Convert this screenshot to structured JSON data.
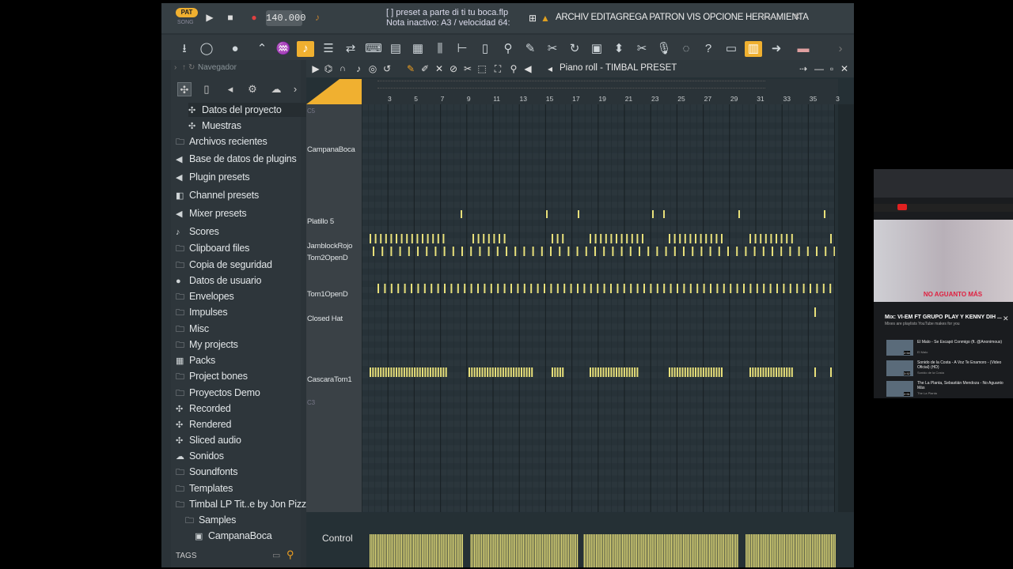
{
  "topbar": {
    "pat_label": "PAT",
    "song_label": "SONG",
    "bpm": "140.000",
    "hint_line1": "[    ] preset a parte di ti tu boca.flp",
    "hint_line2": "Nota inactivo: A3 / velocidad 64:",
    "menu": "ARCHIV EDITAGREGA PATRON VIS OPCIONE HERRAMIENTA"
  },
  "browser": {
    "header": "Navegador",
    "tags_label": "TAGS",
    "items": [
      {
        "label": "Datos del proyecto",
        "icon": "project-data-icon"
      },
      {
        "label": "Muestras",
        "icon": "samples-icon"
      },
      {
        "label": "Archivos recientes",
        "icon": "recent-files-icon"
      },
      {
        "label": "Base de datos de plugins",
        "icon": "plugin-database-icon"
      },
      {
        "label": "Plugin presets",
        "icon": "plugin-presets-icon"
      },
      {
        "label": "Channel presets",
        "icon": "channel-presets-icon"
      },
      {
        "label": "Mixer presets",
        "icon": "mixer-presets-icon"
      },
      {
        "label": "Scores",
        "icon": "scores-icon"
      },
      {
        "label": "Clipboard files",
        "icon": "folder-icon"
      },
      {
        "label": "Copia de seguridad",
        "icon": "backup-icon"
      },
      {
        "label": "Datos de usuario",
        "icon": "user-data-icon"
      },
      {
        "label": "Envelopes",
        "icon": "folder-icon"
      },
      {
        "label": "Impulses",
        "icon": "folder-icon"
      },
      {
        "label": "Misc",
        "icon": "folder-icon"
      },
      {
        "label": "My projects",
        "icon": "folder-icon"
      },
      {
        "label": "Packs",
        "icon": "packs-icon"
      },
      {
        "label": "Project bones",
        "icon": "folder-icon"
      },
      {
        "label": "Proyectos Demo",
        "icon": "folder-icon"
      },
      {
        "label": "Recorded",
        "icon": "recorded-icon"
      },
      {
        "label": "Rendered",
        "icon": "rendered-icon"
      },
      {
        "label": "Sliced audio",
        "icon": "sliced-audio-icon"
      },
      {
        "label": "Sonidos",
        "icon": "cloud-icon"
      },
      {
        "label": "Soundfonts",
        "icon": "folder-icon"
      },
      {
        "label": "Templates",
        "icon": "folder-icon"
      },
      {
        "label": "Timbal LP Tit..e by Jon Pizzio",
        "icon": "folder-open-icon"
      },
      {
        "label": "Samples",
        "icon": "folder-open-icon"
      },
      {
        "label": "CampanaBoca",
        "icon": "sample-icon"
      }
    ]
  },
  "pianoroll": {
    "title": "Piano roll - TIMBAL PRESET",
    "ruler": [
      "3",
      "5",
      "7",
      "9",
      "11",
      "13",
      "15",
      "17",
      "19",
      "21",
      "23",
      "25",
      "27",
      "29",
      "31",
      "33",
      "35",
      "3"
    ],
    "keys": [
      "C5",
      "CampanaBoca",
      "Platillo 5",
      "JamblockRojo",
      "Tom2OpenD",
      "Tom1OpenD",
      "Closed Hat",
      "CascaraTom1",
      "C3"
    ],
    "control_label": "Control"
  },
  "youtube": {
    "title": "Mix: VI-EM FT GRUPO PLAY Y KENNY DIH ...",
    "subtitle": "Mixes are playlists YouTube makes for you",
    "banner_text": "NO AGUANTO MÁS",
    "videos": [
      {
        "title": "El Malo - Se Escapó Conmigo (ft. @Anonimous)",
        "channel": "El Malo",
        "duration": "2:54"
      },
      {
        "title": "Sonido de la Costa - A Voz Te Enamoro - (Video Oficial) (HD)",
        "channel": "Sonido de la Costa",
        "duration": "3:52"
      },
      {
        "title": "The La Planta, Sebastián Mendoza - No Aguanto Más",
        "channel": "The La Planta",
        "duration": "2:51"
      }
    ]
  },
  "colors": {
    "accent": "#f0b030",
    "note": "#e8e07a",
    "grid_bg": "#273238"
  }
}
